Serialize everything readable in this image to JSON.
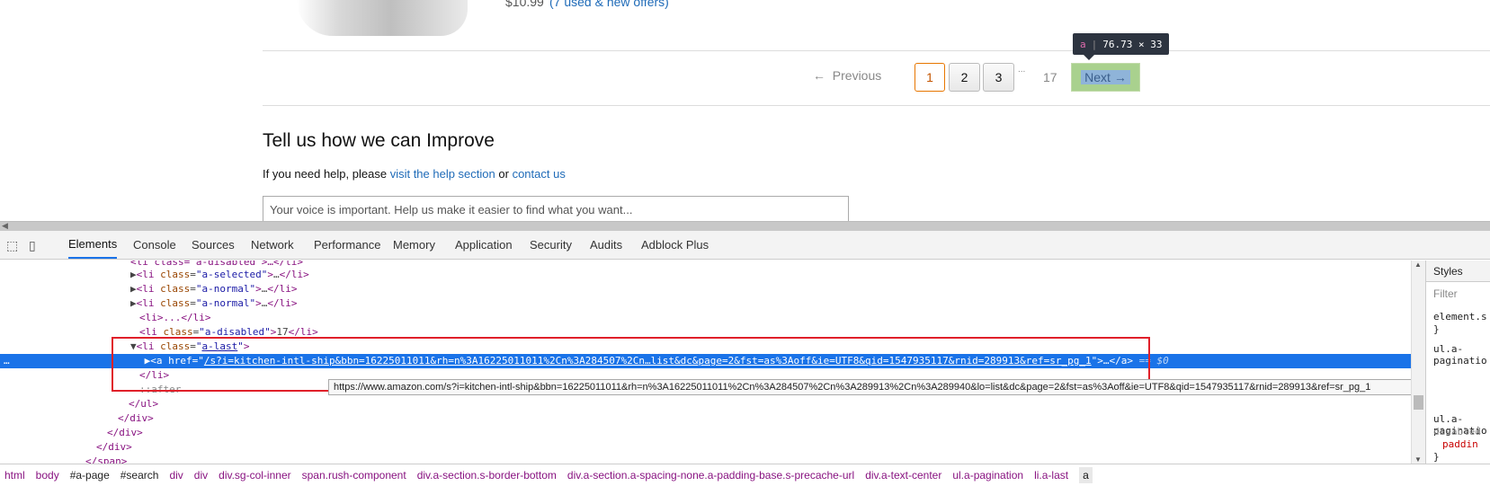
{
  "page": {
    "price": "$10.99",
    "offers_link": "(7 used & new offers)",
    "pagination": {
      "previous_label": "Previous",
      "pages": [
        "1",
        "2",
        "3"
      ],
      "ellipsis": "...",
      "last_page": "17",
      "next_label": "Next"
    },
    "inspect_tooltip": {
      "tag": "a",
      "size": "76.73 × 33"
    },
    "heading": "Tell us how we can Improve",
    "help_text_prefix": "If you need help, please",
    "help_link": "visit the help section",
    "help_or": "or",
    "contact_link": "contact us",
    "voice_placeholder": "Your voice is important. Help us make it easier to find what you want..."
  },
  "devtools": {
    "tabs": [
      "Elements",
      "Console",
      "Sources",
      "Network",
      "Performance",
      "Memory",
      "Application",
      "Security",
      "Audits",
      "Adblock Plus"
    ],
    "active_tab": "Elements",
    "dom_lines": {
      "l0": "<li class=\"a-disabled\">…</li>",
      "l1_class": "a-selected",
      "l2_class": "a-normal",
      "l3_class": "a-normal",
      "l4": "<li>...</li>",
      "l5_class": "a-disabled",
      "l5_text": "17",
      "l6_class": "a-last",
      "sel_href": "/s?i=kitchen-intl-ship&bbn=16225011011&rh=n%3A16225011011%2Cn%3A284507%2Cn…list&dc&page=2&fst=as%3Aoff&ie=UTF8&qid=1547935117&rnid=289913&ref=sr_pg_1",
      "sel_suffix": "== $0",
      "after": "::after",
      "close_ul": "</ul>",
      "close_div": "</div>",
      "close_span": "</span>"
    },
    "url_tooltip": "https://www.amazon.com/s?i=kitchen-intl-ship&bbn=16225011011&rh=n%3A16225011011%2Cn%3A284507%2Cn%3A289913%2Cn%3A289940&lo=list&dc&page=2&fst=as%3Aoff&ie=UTF8&qid=1547935117&rnid=289913&ref=sr_pg_1",
    "styles": {
      "tab": "Styles",
      "filter": "Filter",
      "rule1": "element.s",
      "rule1_close": "}",
      "rule2": "ul.a-paginatio",
      "rule3": "ul.a-paginatio",
      "rule3b": "disabled",
      "rule3c": "paddin",
      "rule3_close": "}",
      "rule4": "ul.a-"
    },
    "breadcrumbs": [
      "html",
      "body",
      "#a-page",
      "#search",
      "div",
      "div",
      "div.sg-col-inner",
      "span.rush-component",
      "div.a-section.s-border-bottom",
      "div.a-section.a-spacing-none.a-padding-base.s-precache-url",
      "div.a-text-center",
      "ul.a-pagination",
      "li.a-last",
      "a"
    ]
  },
  "colors": {
    "accent": "#1a73e8",
    "link": "#1f6bb8",
    "selected_page": "#e77600",
    "highlight_box": "#e0202a"
  }
}
